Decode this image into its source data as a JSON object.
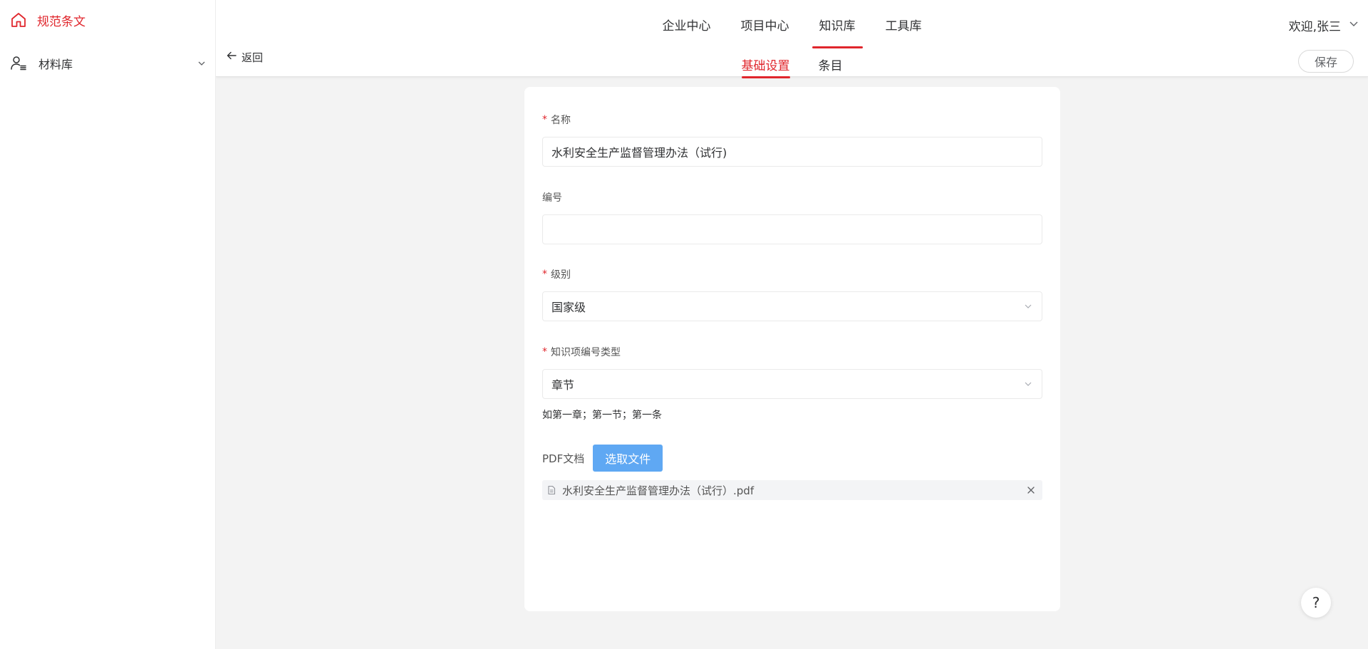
{
  "sidebar": {
    "brand": "规范条文",
    "brand_icon": "home-icon",
    "items": [
      {
        "label": "材料库",
        "icon": "user-list-icon"
      }
    ]
  },
  "header": {
    "nav": [
      "企业中心",
      "项目中心",
      "知识库",
      "工具库"
    ],
    "active_nav": "知识库",
    "user": "欢迎,张三",
    "back": "返回",
    "sub_tabs": [
      "基础设置",
      "条目"
    ],
    "active_sub_tab": "基础设置",
    "save": "保存"
  },
  "form": {
    "name": {
      "label": "名称",
      "required": true,
      "value": "水利安全生产监督管理办法（试行)"
    },
    "code": {
      "label": "编号",
      "required": false,
      "value": ""
    },
    "level": {
      "label": "级别",
      "required": true,
      "value": "国家级"
    },
    "numbering": {
      "label": "知识项编号类型",
      "required": true,
      "value": "章节",
      "hint": "如第一章；第一节；第一条"
    },
    "pdf": {
      "label": "PDF文档",
      "button": "选取文件",
      "file": "水利安全生产监督管理办法（试行）.pdf"
    }
  },
  "help": "?",
  "colors": {
    "accent": "#e0262c",
    "upload": "#5fa8f3",
    "page_bg": "#f3f3f3"
  }
}
